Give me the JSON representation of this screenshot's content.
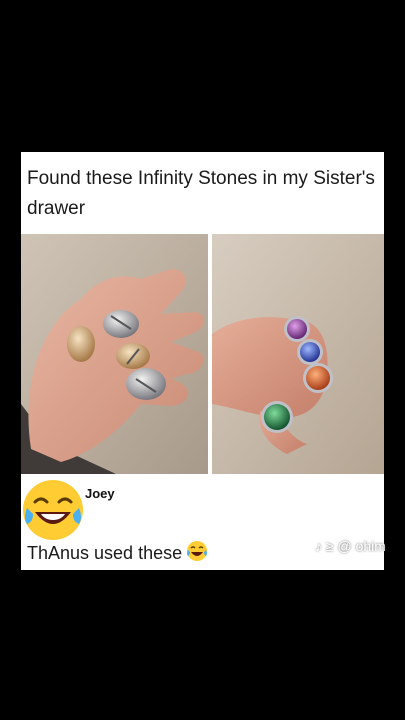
{
  "post": {
    "caption": "Found these Infinity Stones in my Sister's drawer"
  },
  "comment": {
    "username": "Joey",
    "text": "ThAnus used these",
    "emoji_icon": "tears-of-joy-emoji-icon"
  },
  "watermark": {
    "text": "♪ ≥ @ ohim"
  }
}
